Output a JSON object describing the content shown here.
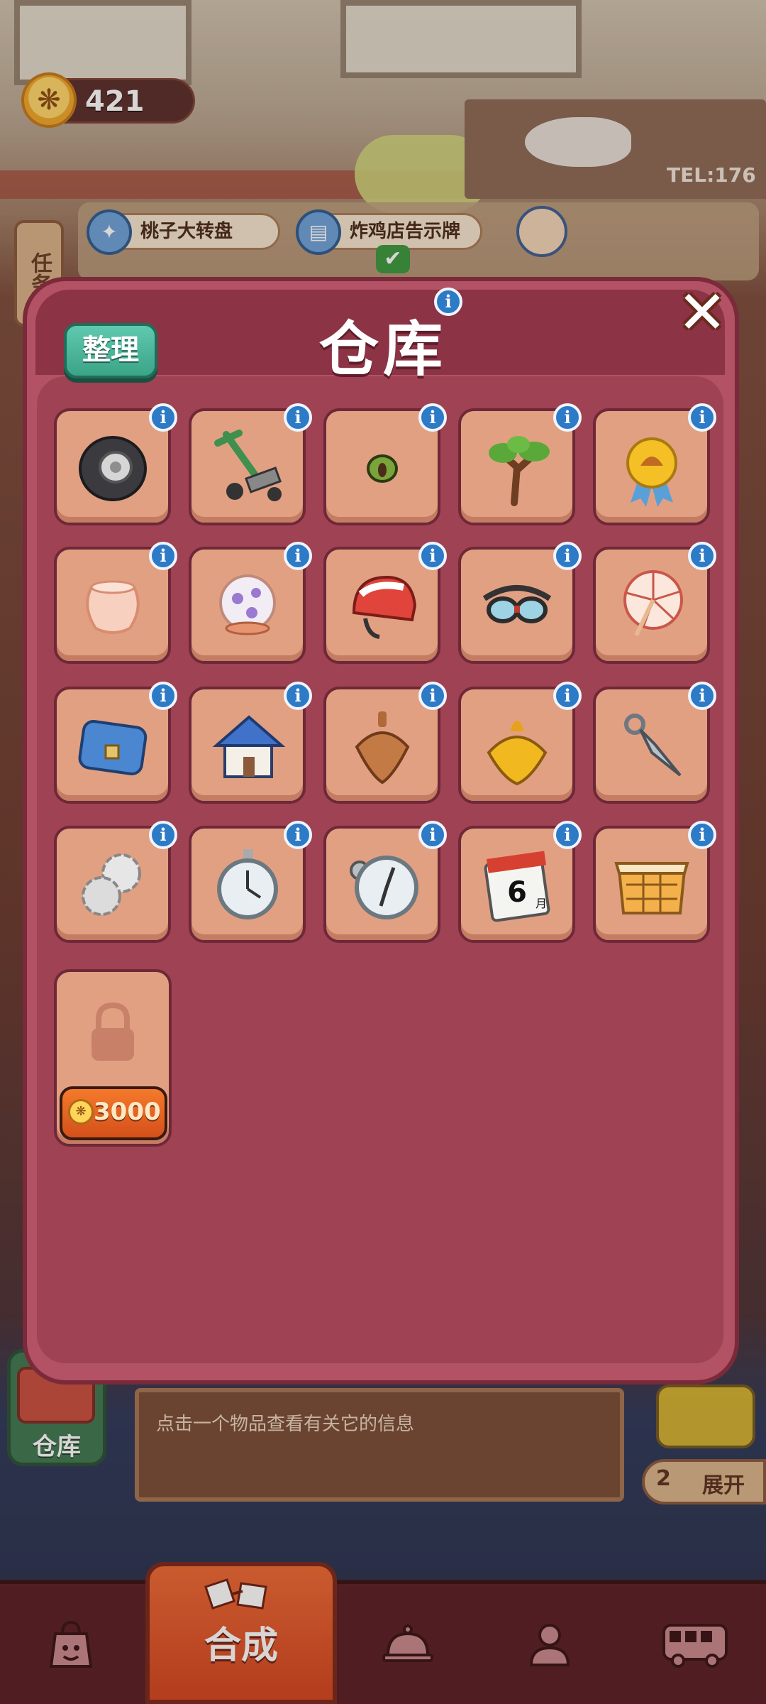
{
  "currency": {
    "paws": "421",
    "paw_icon": "paw-icon"
  },
  "tasks": {
    "tab_label": "任务",
    "items": [
      {
        "label": "桃子大转盘",
        "icon": "flashlight-icon"
      },
      {
        "label": "炸鸡店告示牌",
        "icon": "paint-roller-icon"
      }
    ]
  },
  "background": {
    "tel": "TEL:176"
  },
  "modal": {
    "title": "仓库",
    "sort_label": "整理",
    "close_icon": "close-icon",
    "info_icon": "info-icon",
    "items": [
      {
        "name": "tire",
        "icon": "tire-icon"
      },
      {
        "name": "hand-truck",
        "icon": "hand-truck-icon"
      },
      {
        "name": "seed",
        "icon": "seed-icon"
      },
      {
        "name": "tree",
        "icon": "tree-icon"
      },
      {
        "name": "medal",
        "icon": "medal-icon"
      },
      {
        "name": "glass-jar",
        "icon": "glass-jar-icon"
      },
      {
        "name": "flower-lamp",
        "icon": "flower-lamp-icon"
      },
      {
        "name": "helmet",
        "icon": "helmet-icon"
      },
      {
        "name": "goggles",
        "icon": "goggles-icon"
      },
      {
        "name": "paper-umbrella",
        "icon": "paper-umbrella-icon"
      },
      {
        "name": "blue-bag",
        "icon": "bag-icon"
      },
      {
        "name": "house",
        "icon": "house-icon"
      },
      {
        "name": "wooden-top",
        "icon": "wooden-top-icon"
      },
      {
        "name": "golden-top",
        "icon": "golden-top-icon"
      },
      {
        "name": "kunai",
        "icon": "kunai-icon"
      },
      {
        "name": "gears",
        "icon": "gears-icon"
      },
      {
        "name": "stopwatch",
        "icon": "stopwatch-icon"
      },
      {
        "name": "compass-watch",
        "icon": "compass-icon"
      },
      {
        "name": "calendar",
        "icon": "calendar-icon",
        "text": "6",
        "unit": "月"
      },
      {
        "name": "crate",
        "icon": "crate-icon"
      }
    ],
    "locked_slot": {
      "price": "3000",
      "icon": "lock-icon"
    }
  },
  "info_bar": {
    "hint": "点击一个物品查看有关它的信息"
  },
  "storage_button": {
    "label": "仓库"
  },
  "expand": {
    "count": "2",
    "label": "展开"
  },
  "bottom_nav": {
    "items": [
      {
        "name": "shop",
        "icon": "bag-face-icon"
      },
      {
        "name": "merge",
        "icon": "merge-icon",
        "label": "合成",
        "active": true
      },
      {
        "name": "service",
        "icon": "cloche-icon"
      },
      {
        "name": "staff",
        "icon": "profile-icon"
      },
      {
        "name": "bus",
        "icon": "bus-icon"
      }
    ]
  },
  "colors": {
    "modal_bg": "#b25264",
    "cell_bg": "#e2a083",
    "info_badge": "#2d7ac6",
    "sort_button": "#4cb597",
    "active_tab": "#e25a2b"
  }
}
